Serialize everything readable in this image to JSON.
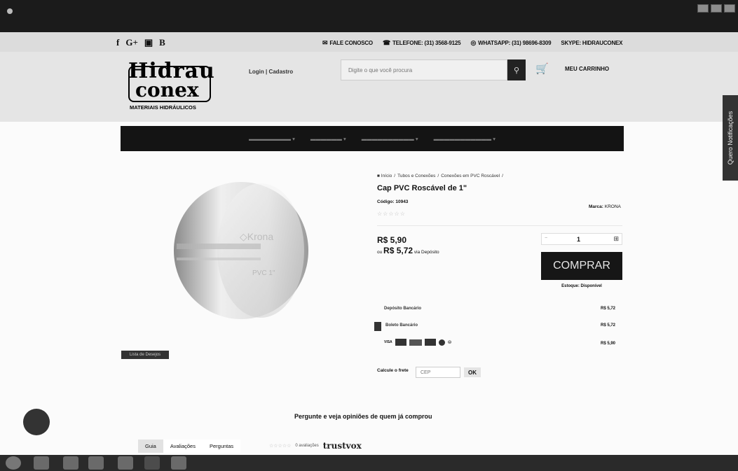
{
  "topbar": {
    "social": [
      "f",
      "G+",
      "▣",
      "B"
    ],
    "contacts": {
      "fale_conosco": "FALE CONOSCO",
      "telefone": "TELEFONE: (31) 3568-9125",
      "whatsapp": "WHATSAPP: (31) 98696-8309",
      "skype": "SKYPE: HIDRAUCONEX"
    }
  },
  "header": {
    "logo": {
      "line1": "Hidrau",
      "line2": "conex",
      "tagline": "MATERIAIS HIDRÁULICOS"
    },
    "login": "Login | Cadastro",
    "search": {
      "placeholder": "Digite o que você procura"
    },
    "cart": "MEU CARRINHO"
  },
  "notifications_tab": "Quero Notificações",
  "breadcrumb": [
    "Início",
    "Tubos e Conexões",
    "Conexões em PVC Roscável"
  ],
  "product": {
    "title": "Cap PVC Roscável de 1\"",
    "code_label": "Código: 10943",
    "brand_label": "Marca:",
    "brand": "KRONA",
    "stars": "☆☆☆☆☆",
    "price": "R$ 5,90",
    "price_alt_prefix": "ou",
    "price_alt": "R$ 5,72",
    "price_alt_suffix": "via Depósito",
    "qty": "1",
    "buy_label": "COMPRAR",
    "stock": "Estoque: Disponível",
    "wishlist": "Lista de Desejos"
  },
  "payments": [
    {
      "name": "Depósito Bancário",
      "amount": "R$ 5,72"
    },
    {
      "name": "Boleto Bancário",
      "amount": "R$ 5,72"
    },
    {
      "name": "VISA",
      "amount": "R$ 5,90"
    }
  ],
  "freight": {
    "label": "Calcule o frete",
    "placeholder": "CEP",
    "button": "OK"
  },
  "qa": {
    "heading": "Pergunte e veja opiniões de quem já comprou",
    "tabs": [
      "Guia",
      "Avaliações",
      "Perguntas"
    ],
    "reviews_count": "0 avaliações",
    "trustvox": "trustvox"
  }
}
